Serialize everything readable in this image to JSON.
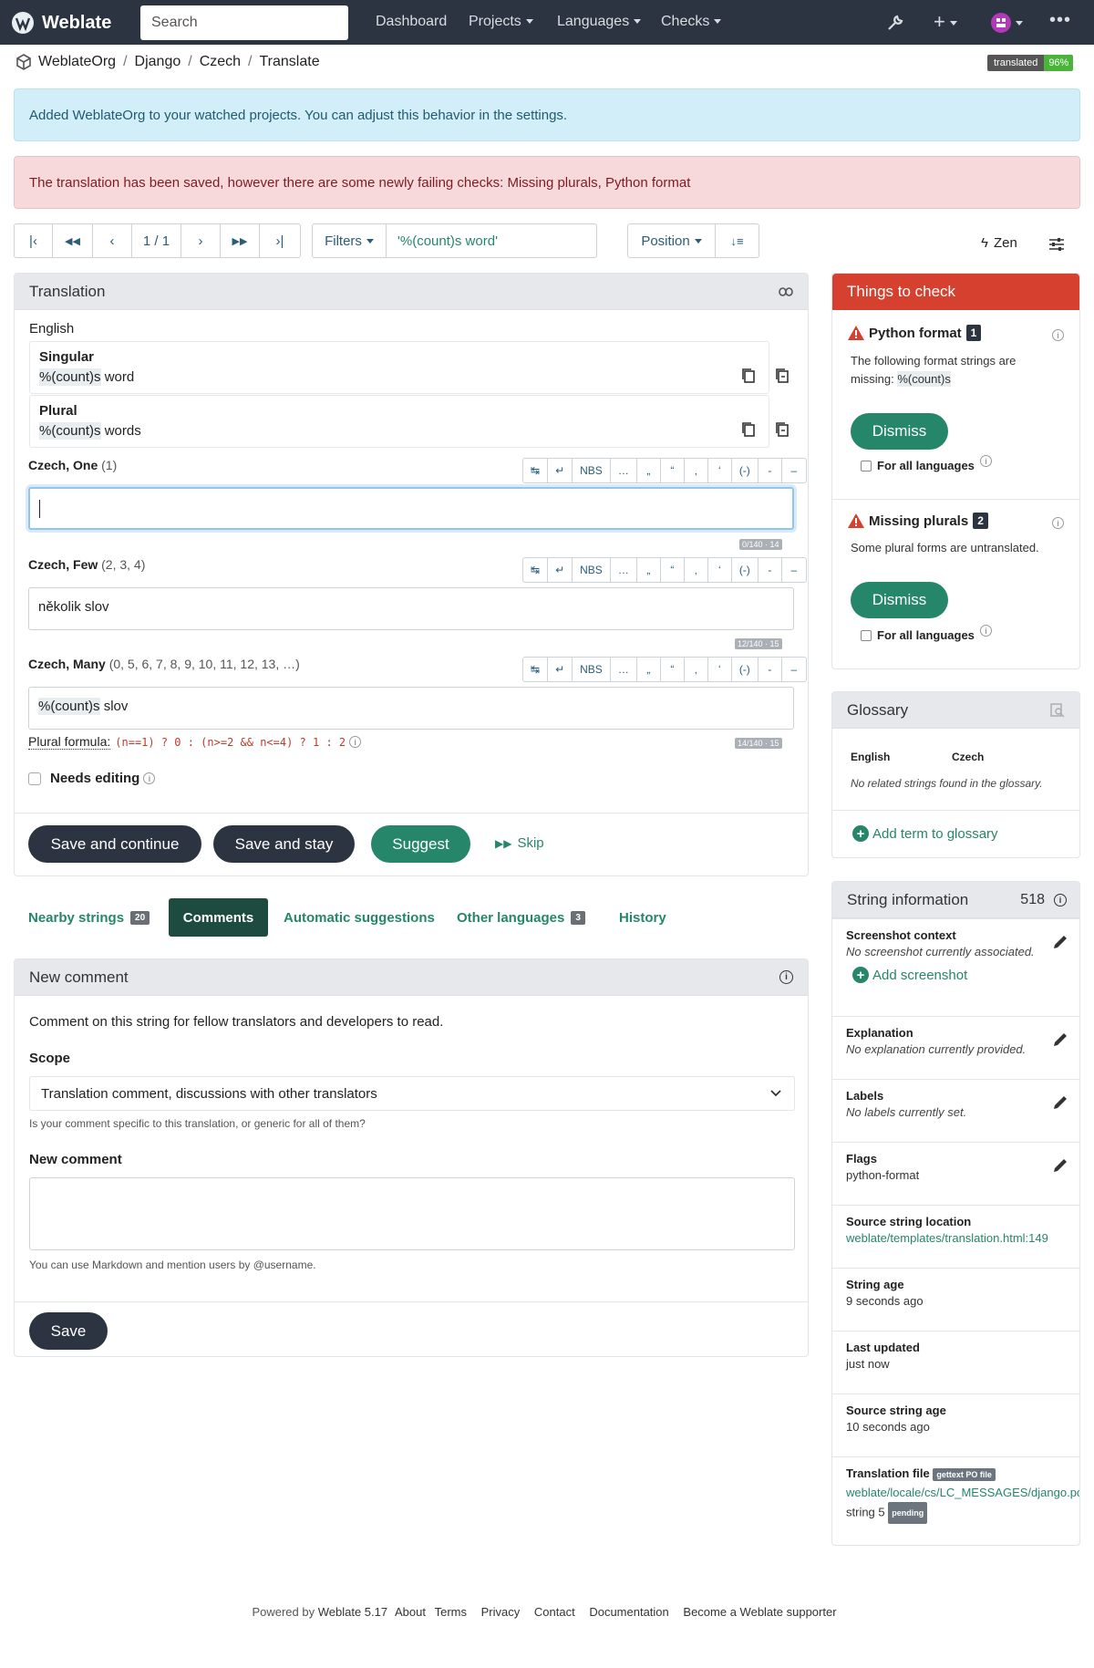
{
  "nav": {
    "brand": "Weblate",
    "search_placeholder": "Search",
    "links": [
      "Dashboard",
      "Projects",
      "Languages",
      "Checks"
    ]
  },
  "breadcrumb": [
    "WeblateOrg",
    "Django",
    "Czech",
    "Translate"
  ],
  "progress": {
    "label": "translated",
    "value": "96%"
  },
  "alerts": {
    "info": "Added WeblateOrg to your watched projects. You can adjust this behavior in the settings.",
    "danger": "The translation has been saved, however there are some newly failing checks: Missing plurals, Python format"
  },
  "pager": {
    "position": "1 / 1"
  },
  "filters": {
    "label": "Filters",
    "query": "'%(count)s word'"
  },
  "sort": {
    "label": "Position"
  },
  "zen": "Zen",
  "translation": {
    "title": "Translation",
    "source_lang": "English",
    "singular_label": "Singular",
    "singular_placeholder": "%(count)s",
    "singular_text": " word",
    "plural_label": "Plural",
    "plural_placeholder": "%(count)s",
    "plural_text": " words",
    "toolbar_nbs": "NBS",
    "forms": [
      {
        "name": "Czech, One",
        "nums": "(1)",
        "value": "",
        "counter": "0/140 · 14"
      },
      {
        "name": "Czech, Few",
        "nums": "(2, 3, 4)",
        "value": "několik slov",
        "counter": "12/140 · 15"
      },
      {
        "name": "Czech, Many",
        "nums": "(0, 5, 6, 7, 8, 9, 10, 11, 12, 13, …)",
        "value_placeholder": "%(count)s",
        "value_text": " slov",
        "counter": "14/140 · 15"
      }
    ],
    "plural_formula_label": "Plural formula:",
    "plural_formula": "(n==1) ? 0 : (n>=2 && n<=4) ? 1 : 2",
    "needs_editing": "Needs editing",
    "buttons": {
      "save_continue": "Save and continue",
      "save_stay": "Save and stay",
      "suggest": "Suggest",
      "skip": "Skip"
    }
  },
  "tabs": {
    "nearby": "Nearby strings",
    "nearby_count": "20",
    "comments": "Comments",
    "auto": "Automatic suggestions",
    "other": "Other languages",
    "other_count": "3",
    "history": "History"
  },
  "comment": {
    "title": "New comment",
    "intro": "Comment on this string for fellow translators and developers to read.",
    "scope_label": "Scope",
    "scope_value": "Translation comment, discussions with other translators",
    "scope_help": "Is your comment specific to this translation, or generic for all of them?",
    "new_label": "New comment",
    "new_help": "You can use Markdown and mention users by @username.",
    "save": "Save"
  },
  "checks": {
    "title": "Things to check",
    "items": [
      {
        "name": "Python format",
        "num": "1",
        "desc": "The following format strings are missing:",
        "code": "%(count)s",
        "dismiss": "Dismiss",
        "all": "For all languages"
      },
      {
        "name": "Missing plurals",
        "num": "2",
        "desc": "Some plural forms are untranslated.",
        "dismiss": "Dismiss",
        "all": "For all languages"
      }
    ]
  },
  "glossary": {
    "title": "Glossary",
    "col_en": "English",
    "col_cs": "Czech",
    "empty": "No related strings found in the glossary.",
    "add": "Add term to glossary"
  },
  "info": {
    "title": "String information",
    "id": "518",
    "screenshot_t": "Screenshot context",
    "screenshot_v": "No screenshot currently associated.",
    "add_screenshot": "Add screenshot",
    "explanation_t": "Explanation",
    "explanation_v": "No explanation currently provided.",
    "labels_t": "Labels",
    "labels_v": "No labels currently set.",
    "flags_t": "Flags",
    "flags_v": "python-format",
    "location_t": "Source string location",
    "location_v": "weblate/templates/translation.html:149",
    "age_t": "String age",
    "age_v": "9 seconds ago",
    "updated_t": "Last updated",
    "updated_v": "just now",
    "srcage_t": "Source string age",
    "srcage_v": "10 seconds ago",
    "file_t": "Translation file",
    "file_badge": "gettext PO file",
    "file_v1": "weblate/locale/cs/LC_MESSAGES/django",
    "file_v2": ".po",
    "file_v3": ", string 5",
    "file_pending": "pending"
  },
  "footer": {
    "powered": "Powered by",
    "version": "Weblate 5.17",
    "links": [
      "About",
      "Terms",
      "Privacy",
      "Contact",
      "Documentation",
      "Become a Weblate supporter"
    ]
  },
  "colors": {
    "brand_green": "#26866a",
    "danger": "#d5412e",
    "navbar": "#2b3440"
  }
}
